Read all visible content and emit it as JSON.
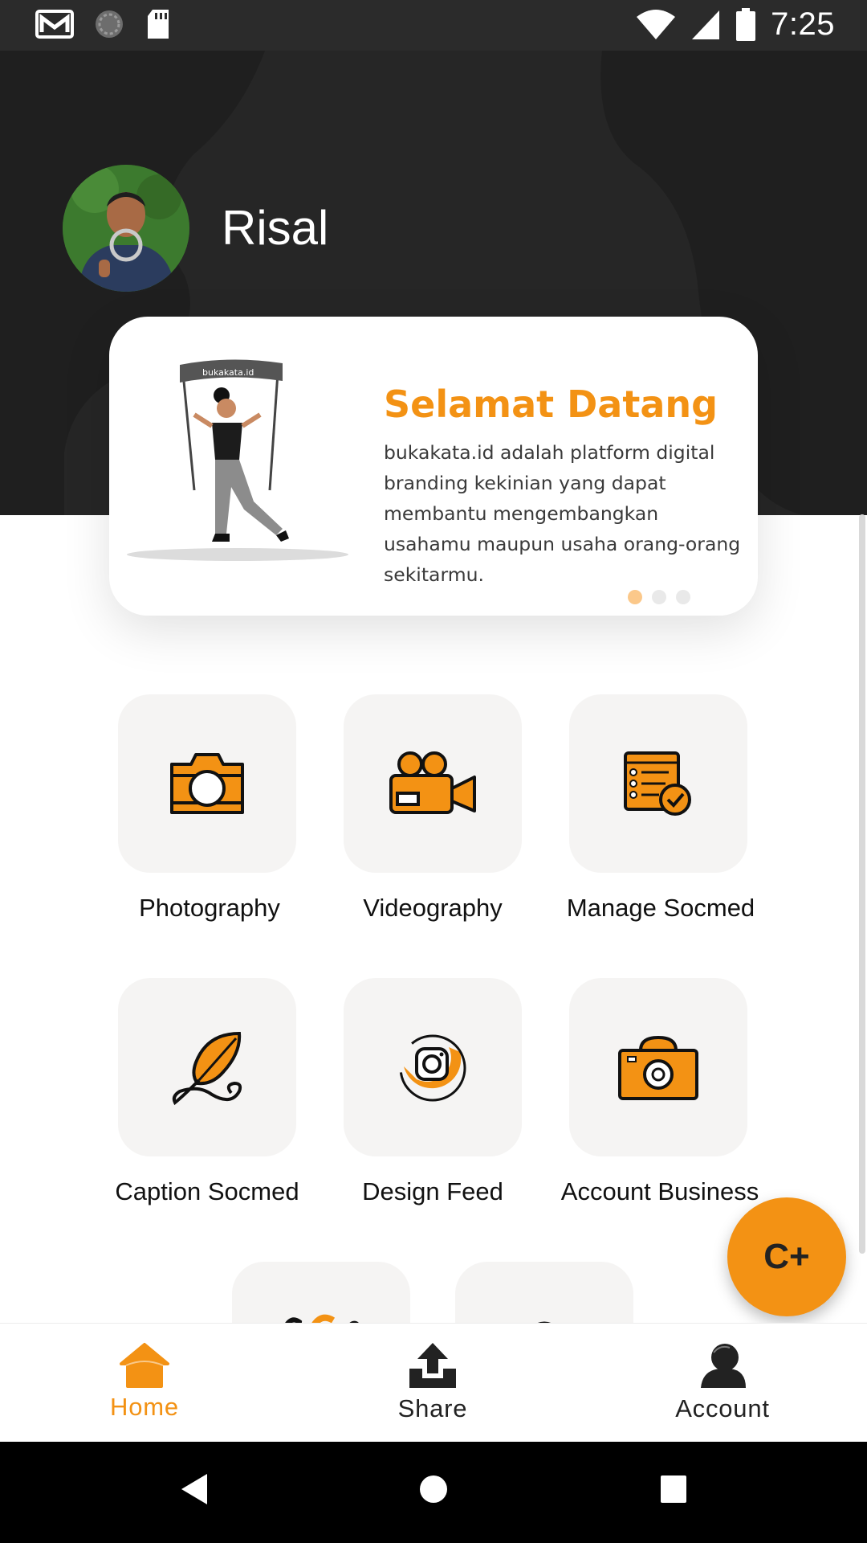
{
  "status_bar": {
    "time": "7:25",
    "icons": [
      "gmail-icon",
      "sync-icon",
      "sd-card-icon",
      "wifi-icon",
      "signal-icon",
      "battery-icon"
    ]
  },
  "profile": {
    "name": "Risal"
  },
  "welcome": {
    "banner_text": "bukakata.id",
    "title": "Selamat Datang",
    "description": "bukakata.id adalah platform digital branding kekinian yang dapat membantu mengembangkan usahamu maupun usaha orang-orang sekitarmu.",
    "slides_total": 3,
    "active_slide": 1
  },
  "services": [
    {
      "label": "Photography",
      "icon": "camera-icon"
    },
    {
      "label": "Videography",
      "icon": "video-camera-icon"
    },
    {
      "label": "Manage Socmed",
      "icon": "checklist-icon"
    },
    {
      "label": "Caption Socmed",
      "icon": "feather-pen-icon"
    },
    {
      "label": "Design Feed",
      "icon": "instagram-icon"
    },
    {
      "label": "Account Business",
      "icon": "business-camera-icon"
    }
  ],
  "fab": {
    "label": "C+"
  },
  "bottom_nav": [
    {
      "label": "Home",
      "icon": "home-icon",
      "active": true
    },
    {
      "label": "Share",
      "icon": "share-upload-icon",
      "active": false
    },
    {
      "label": "Account",
      "icon": "account-icon",
      "active": false
    }
  ],
  "colors": {
    "accent": "#f39214",
    "header_bg": "#262626",
    "tile_bg": "#f5f4f3"
  }
}
